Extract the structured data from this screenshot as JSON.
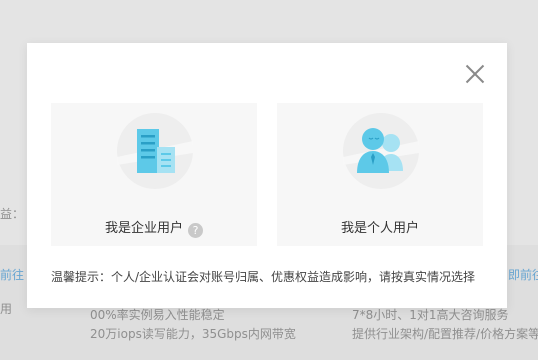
{
  "background": {
    "left_label": "益：",
    "left_link": "前往",
    "left_small": "用",
    "mid_line1": "00%率实例易入性能稳定",
    "mid_line2": "20万iops读写能力，35Gbps内网带宽",
    "right_line1": "7*8小时、1对1高大咨询服务",
    "right_line2": "提供行业架构/配置推荐/价格方案等",
    "right_link": "即前往"
  },
  "modal": {
    "enterprise_label": "我是企业用户",
    "help_glyph": "?",
    "personal_label": "我是个人用户",
    "tip": "温馨提示：个人/企业认证会对账号归属、优惠权益造成影响，请按真实情况选择"
  },
  "colors": {
    "illustration_blue": "#5dc9e8",
    "card_bg": "#f7f7f7",
    "circle_bg": "#eeeeee"
  },
  "icons": [
    "close-icon",
    "building-icon",
    "help-icon",
    "users-icon"
  ]
}
